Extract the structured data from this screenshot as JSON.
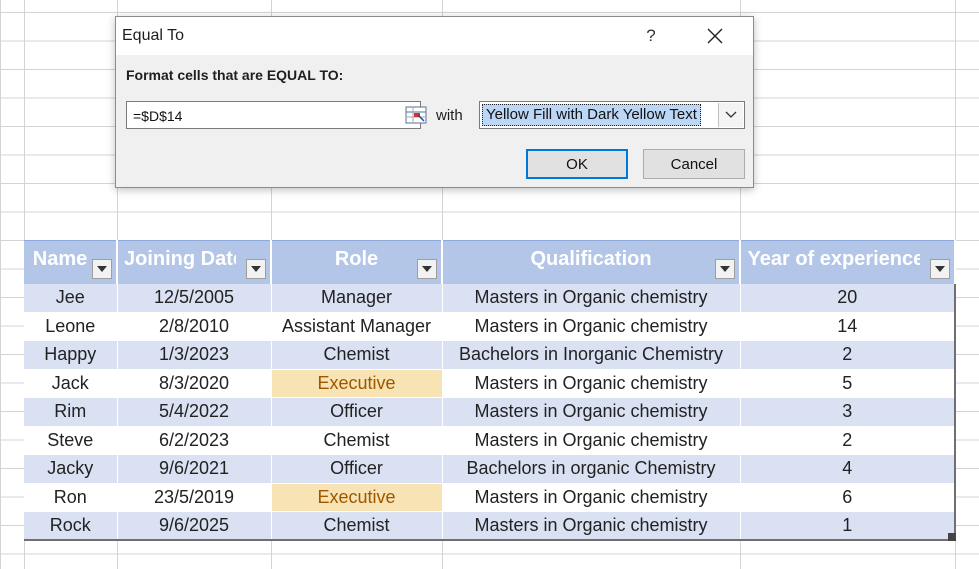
{
  "dialog": {
    "title": "Equal To",
    "help_label": "?",
    "instruction": "Format cells that are EQUAL TO:",
    "value": "=$D$14",
    "with_label": "with",
    "format_selected": "Yellow Fill with Dark Yellow Text",
    "ok_label": "OK",
    "cancel_label": "Cancel",
    "icons": {
      "close": "close-icon",
      "range_select": "collapse-dialog-icon",
      "dropdown": "chevron-down-icon"
    }
  },
  "table": {
    "headers": [
      "Name",
      "Joining Date",
      "Role",
      "Qualification",
      "Year of experience"
    ],
    "rows": [
      {
        "name": "Jee",
        "date": "12/5/2005",
        "role": "Manager",
        "qualification": "Masters in Organic chemistry",
        "years": "20"
      },
      {
        "name": "Leone",
        "date": "2/8/2010",
        "role": "Assistant Manager",
        "qualification": "Masters in Organic chemistry",
        "years": "14"
      },
      {
        "name": "Happy",
        "date": "1/3/2023",
        "role": "Chemist",
        "qualification": "Bachelors in Inorganic Chemistry",
        "years": "2"
      },
      {
        "name": "Jack",
        "date": "8/3/2020",
        "role": "Executive",
        "qualification": "Masters in Organic chemistry",
        "years": "5"
      },
      {
        "name": "Rim",
        "date": "5/4/2022",
        "role": "Officer",
        "qualification": "Masters in Organic chemistry",
        "years": "3"
      },
      {
        "name": "Steve",
        "date": "6/2/2023",
        "role": "Chemist",
        "qualification": "Masters in Organic chemistry",
        "years": "2"
      },
      {
        "name": "Jacky",
        "date": "9/6/2021",
        "role": "Officer",
        "qualification": "Bachelors in organic Chemistry",
        "years": "4"
      },
      {
        "name": "Ron",
        "date": "23/5/2019",
        "role": "Executive",
        "qualification": "Masters in Organic chemistry",
        "years": "6"
      },
      {
        "name": "Rock",
        "date": "9/6/2025",
        "role": "Chemist",
        "qualification": "Masters in Organic chemistry",
        "years": "1"
      }
    ],
    "highlight_value": "Executive",
    "colors": {
      "header_bg": "#b4c6e7",
      "band_bg": "#e7ecf6",
      "highlight_fill": "#f8e3b4",
      "highlight_text": "#9c5700"
    }
  }
}
